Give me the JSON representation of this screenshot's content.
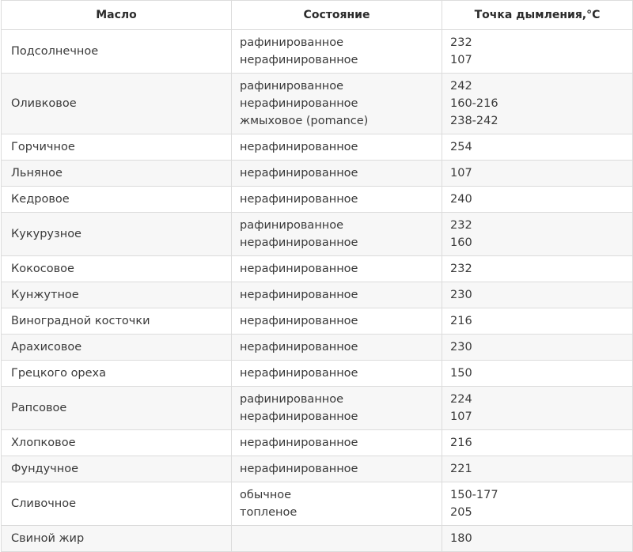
{
  "headers": {
    "oil": "Масло",
    "state": "Состояние",
    "smoke_point": "Точка дымления,°C"
  },
  "rows": [
    {
      "oil": "Подсолнечное",
      "states": [
        "рафинированное",
        "нерафинированное"
      ],
      "points": [
        "232",
        "107"
      ]
    },
    {
      "oil": "Оливковое",
      "states": [
        "рафинированное",
        "нерафинированное",
        "жмыховое (pomance)"
      ],
      "points": [
        "242",
        "160-216",
        "238-242"
      ]
    },
    {
      "oil": "Горчичное",
      "states": [
        "нерафинированное"
      ],
      "points": [
        "254"
      ]
    },
    {
      "oil": "Льняное",
      "states": [
        "нерафинированное"
      ],
      "points": [
        "107"
      ]
    },
    {
      "oil": "Кедровое",
      "states": [
        "нерафинированное"
      ],
      "points": [
        "240"
      ]
    },
    {
      "oil": "Кукурузное",
      "states": [
        "рафинированное",
        "нерафинированное"
      ],
      "points": [
        "232",
        "160"
      ]
    },
    {
      "oil": "Кокосовое",
      "states": [
        "нерафинированное"
      ],
      "points": [
        "232"
      ]
    },
    {
      "oil": "Кунжутное",
      "states": [
        "нерафинированное"
      ],
      "points": [
        "230"
      ]
    },
    {
      "oil": "Виноградной косточки",
      "states": [
        "нерафинированное"
      ],
      "points": [
        "216"
      ]
    },
    {
      "oil": "Арахисовое",
      "states": [
        "нерафинированное"
      ],
      "points": [
        "230"
      ]
    },
    {
      "oil": "Грецкого ореха",
      "states": [
        "нерафинированное"
      ],
      "points": [
        "150"
      ]
    },
    {
      "oil": "Рапсовое",
      "states": [
        "рафинированное",
        "нерафинированное"
      ],
      "points": [
        "224",
        "107"
      ]
    },
    {
      "oil": "Хлопковое",
      "states": [
        "нерафинированное"
      ],
      "points": [
        "216"
      ]
    },
    {
      "oil": "Фундучное",
      "states": [
        "нерафинированное"
      ],
      "points": [
        "221"
      ]
    },
    {
      "oil": "Сливочное",
      "states": [
        "обычное",
        "топленое"
      ],
      "points": [
        "150-177",
        "205"
      ]
    },
    {
      "oil": "Свиной жир",
      "states": [],
      "points": [
        "180"
      ]
    }
  ]
}
